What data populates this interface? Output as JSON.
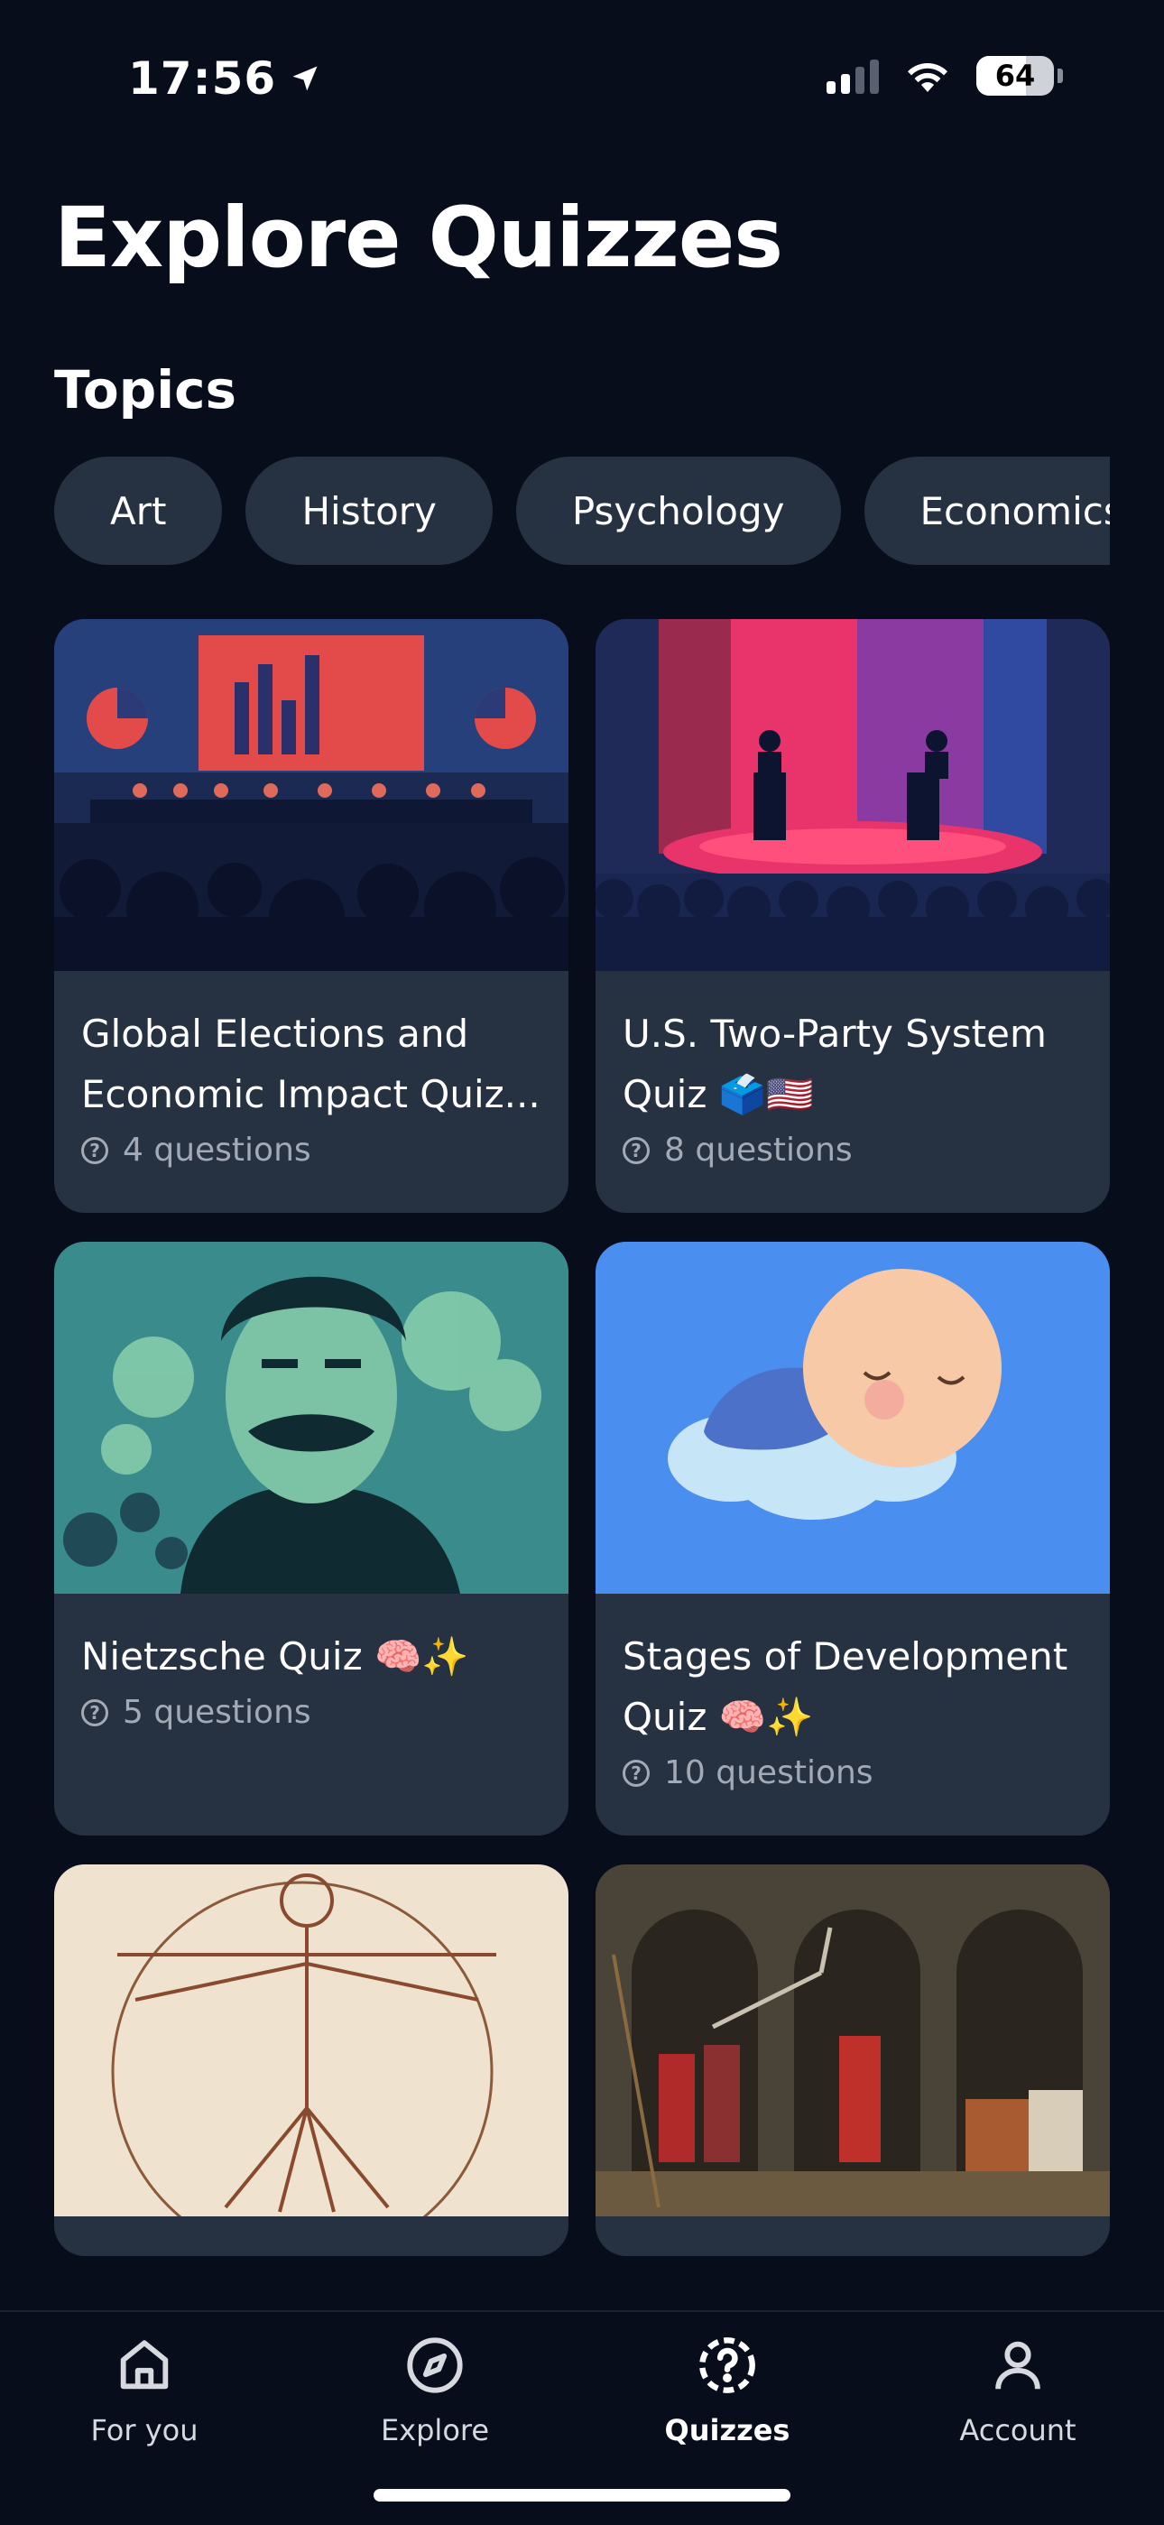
{
  "status_bar": {
    "time": "17:56",
    "battery": "64"
  },
  "page_title": "Explore Quizzes",
  "topics": {
    "heading": "Topics",
    "chips": [
      "Art",
      "History",
      "Psychology",
      "Economics"
    ]
  },
  "quizzes": [
    {
      "title": "Global Elections and Economic Impact Quiz...",
      "meta": "4 questions"
    },
    {
      "title": "U.S. Two-Party System Quiz 🗳️🇺🇸",
      "meta": "8 questions"
    },
    {
      "title": "Nietzsche Quiz 🧠✨",
      "meta": "5 questions"
    },
    {
      "title": "Stages of Development Quiz 🧠✨",
      "meta": "10 questions"
    },
    {
      "title": "",
      "meta": ""
    },
    {
      "title": "",
      "meta": ""
    }
  ],
  "tabbar": {
    "items": [
      {
        "label": "For you",
        "icon": "home-icon"
      },
      {
        "label": "Explore",
        "icon": "compass-icon"
      },
      {
        "label": "Quizzes",
        "icon": "quiz-icon",
        "active": true
      },
      {
        "label": "Account",
        "icon": "account-icon"
      }
    ]
  }
}
